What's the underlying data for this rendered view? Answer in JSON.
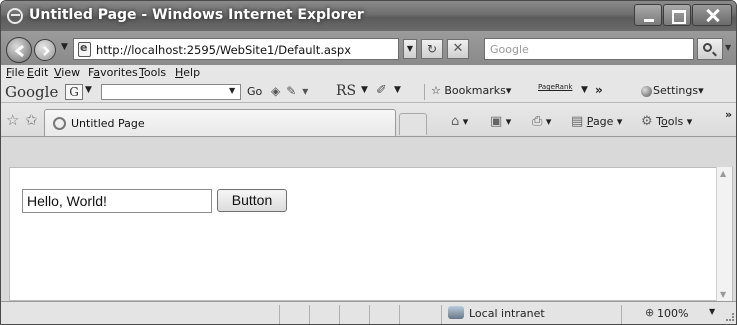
{
  "window": {
    "title": "Untitled Page - Windows Internet Explorer"
  },
  "address": {
    "url": "http://localhost:2595/WebSite1/Default.aspx",
    "search_placeholder": "Google"
  },
  "menubar": {
    "items": [
      {
        "first": "F",
        "rest": "ile"
      },
      {
        "first": "E",
        "rest": "dit"
      },
      {
        "first": "V",
        "rest": "iew"
      },
      {
        "prefix": "F",
        "first": "a",
        "rest": "vorites"
      },
      {
        "first": "T",
        "rest": "ools"
      },
      {
        "first": "H",
        "rest": "elp"
      }
    ]
  },
  "google_toolbar": {
    "logo": "Google",
    "g_button": "G",
    "go_label": "Go",
    "rs_label": "RS",
    "bookmarks_label": "Bookmarks",
    "pagerank_label": "PageRank",
    "more_label": "»",
    "settings_label": "Settings"
  },
  "tabs": {
    "active_title": "Untitled Page"
  },
  "command_bar": {
    "page_rest": "age",
    "page_underline": "P",
    "tools_prefix": "T",
    "tools_underline": "o",
    "tools_rest": "ols",
    "more_label": "»"
  },
  "page": {
    "textbox_value": "Hello, World!",
    "button_label": "Button"
  },
  "status": {
    "zone": "Local intranet",
    "zoom": "100%"
  }
}
